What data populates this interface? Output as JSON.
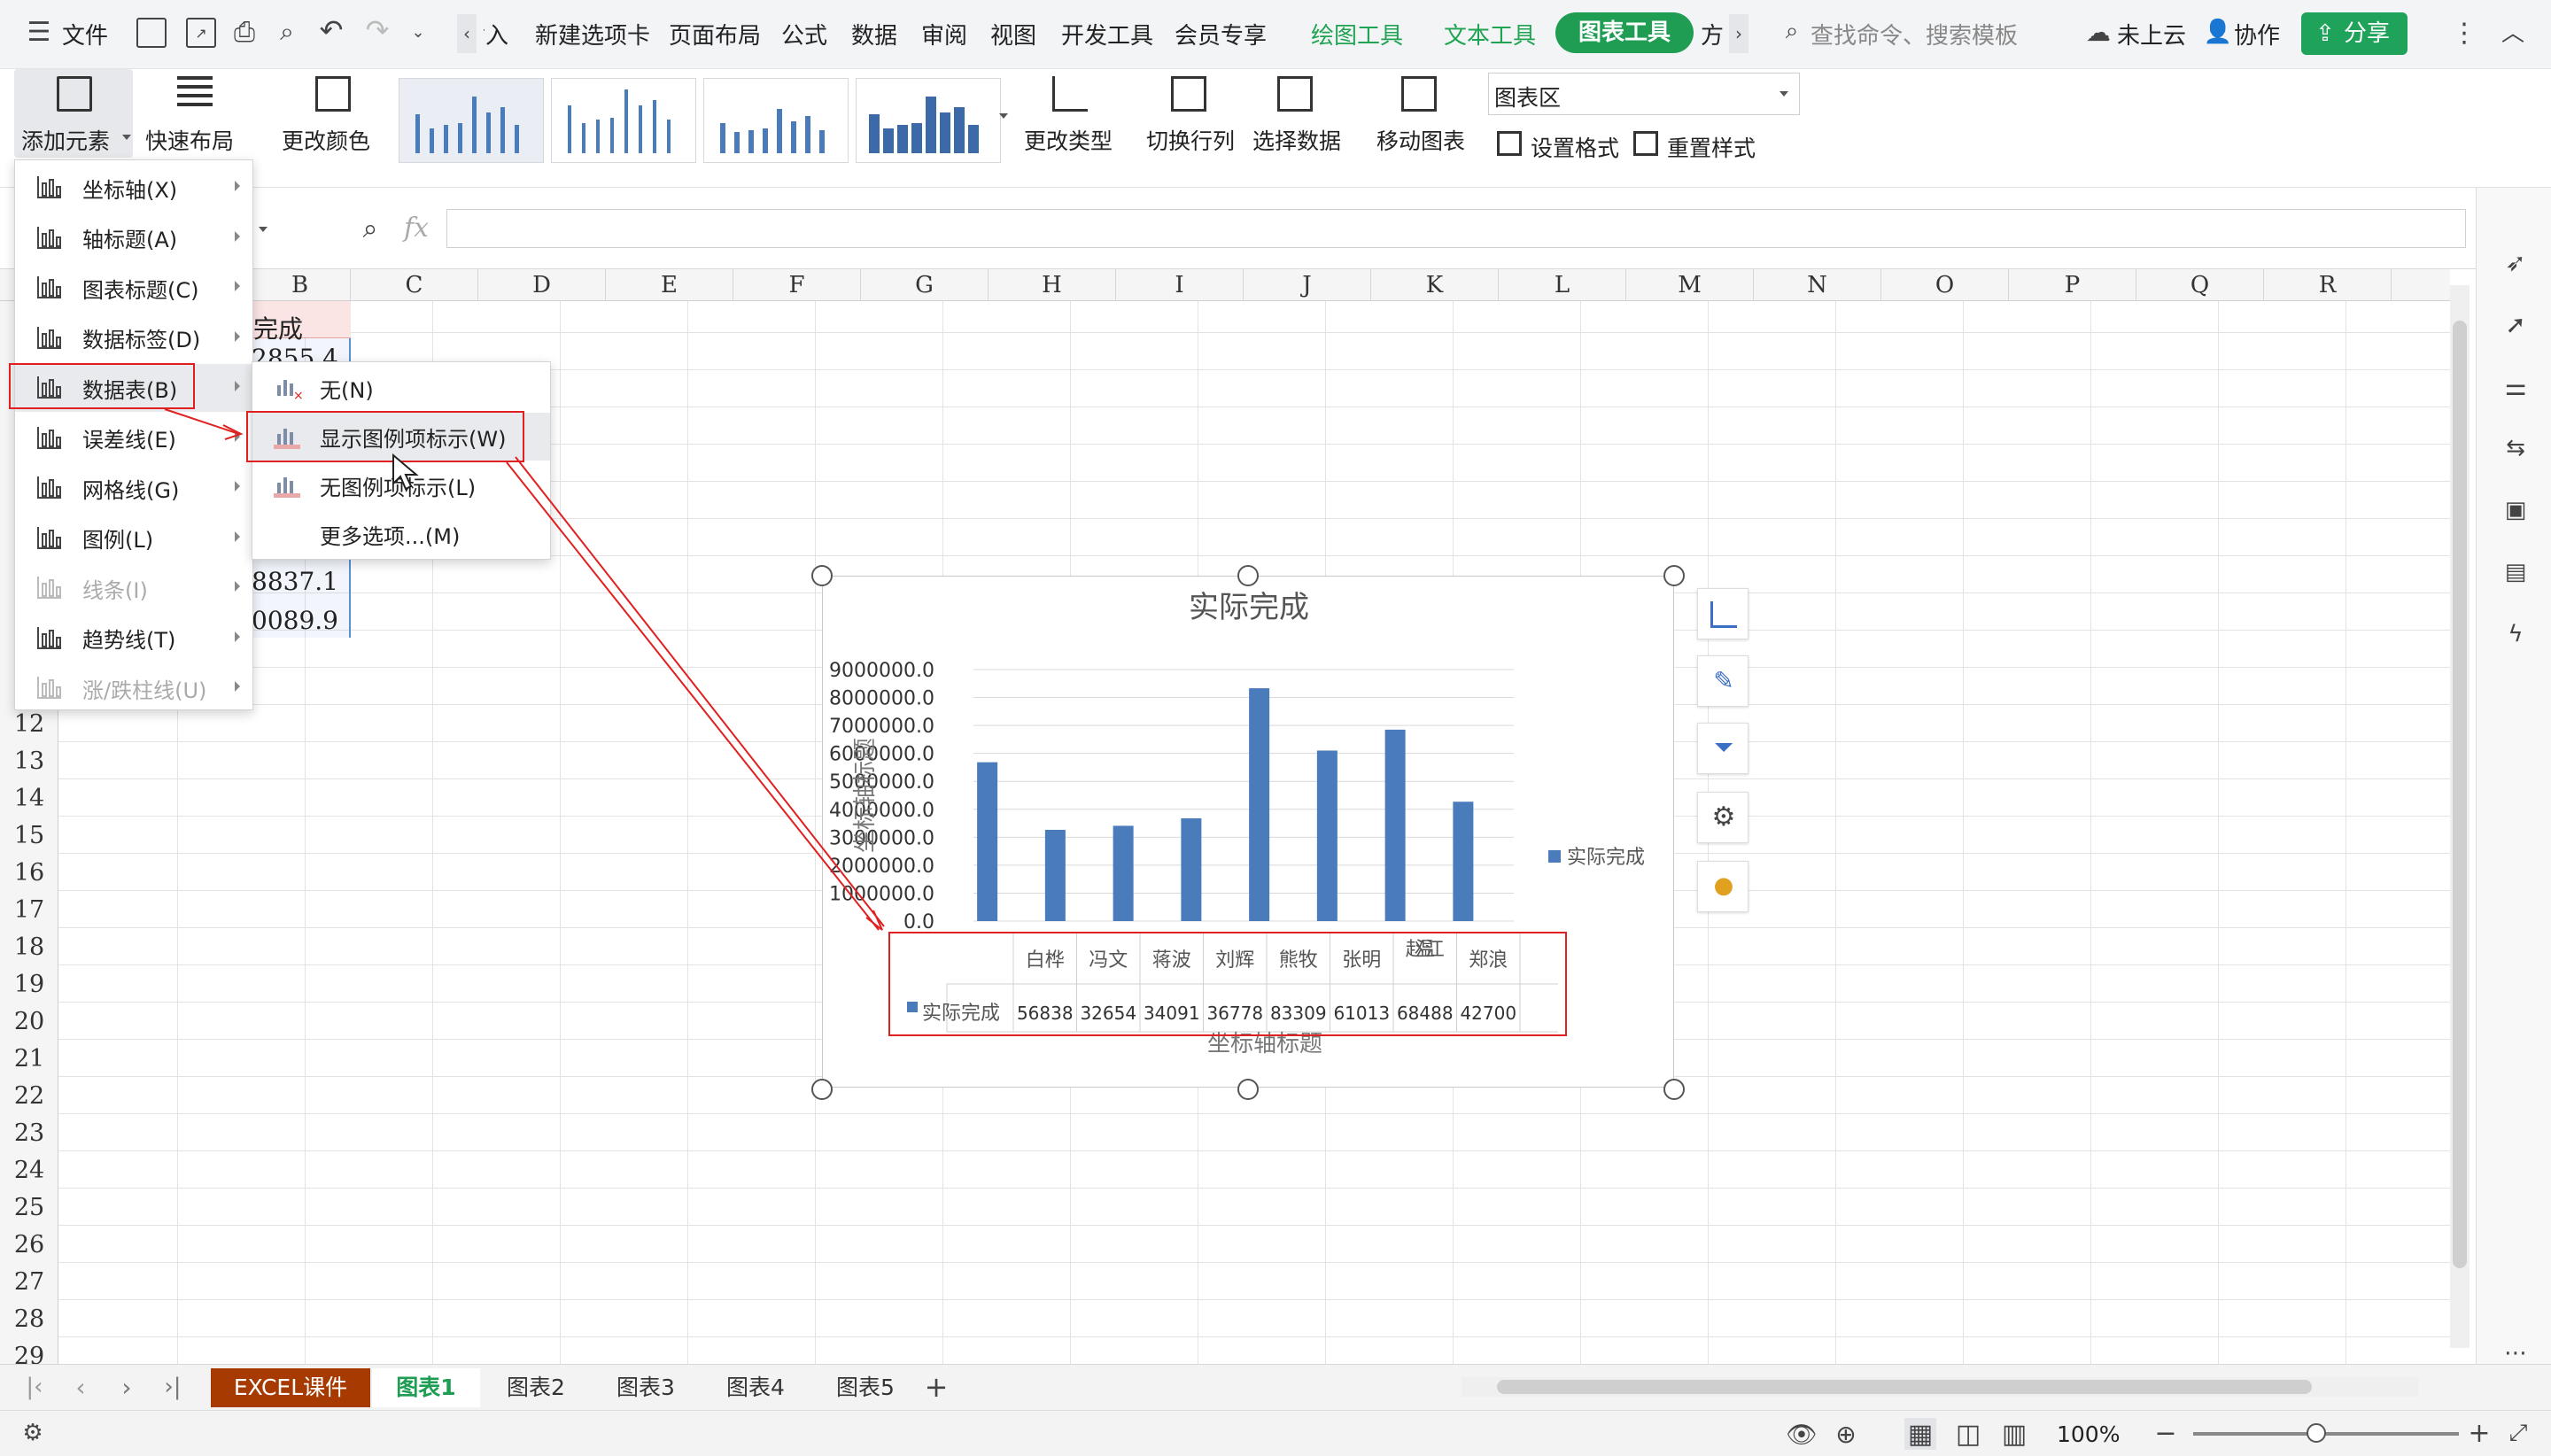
{
  "topbar": {
    "file_menu": "文件",
    "tabs": [
      "插入",
      "新建选项卡",
      "页面布局",
      "公式",
      "数据",
      "审阅",
      "视图",
      "开发工具",
      "会员专享"
    ],
    "tab_first_partial": "‹ 入",
    "context_tabs": [
      "绘图工具",
      "文本工具"
    ],
    "active_tab": "图表工具",
    "tab_more": "方",
    "search_placeholder": "查找命令、搜索模板",
    "cloud": "未上云",
    "collab": "协作",
    "share": "分享"
  },
  "ribbon": {
    "add_element": "添加元素",
    "quick_layout": "快速布局",
    "change_color": "更改颜色",
    "change_type": "更改类型",
    "switch_row_col": "切换行列",
    "select_data": "选择数据",
    "move_chart": "移动图表",
    "chart_area_select": "图表区",
    "set_format": "设置格式",
    "reset_style": "重置样式"
  },
  "formula": {
    "fx": "fx"
  },
  "columns": [
    "B",
    "C",
    "D",
    "E",
    "F",
    "G",
    "H",
    "I",
    "J",
    "K",
    "L",
    "M",
    "N",
    "O",
    "P",
    "Q",
    "R"
  ],
  "rows": [
    "12",
    "13",
    "14",
    "15",
    "16",
    "17",
    "18",
    "19",
    "20",
    "21",
    "22",
    "23",
    "24",
    "25",
    "26",
    "27",
    "28",
    "29"
  ],
  "cells": {
    "b1": "完成",
    "b2": "2855.4",
    "b10": "8837.1",
    "b11": "0089.9"
  },
  "menu1": {
    "items": [
      {
        "label": "坐标轴(X)",
        "disabled": false
      },
      {
        "label": "轴标题(A)",
        "disabled": false
      },
      {
        "label": "图表标题(C)",
        "disabled": false
      },
      {
        "label": "数据标签(D)",
        "disabled": false
      },
      {
        "label": "数据表(B)",
        "disabled": false
      },
      {
        "label": "误差线(E)",
        "disabled": false
      },
      {
        "label": "网格线(G)",
        "disabled": false
      },
      {
        "label": "图例(L)",
        "disabled": false
      },
      {
        "label": "线条(I)",
        "disabled": true
      },
      {
        "label": "趋势线(T)",
        "disabled": false
      },
      {
        "label": "涨/跌柱线(U)",
        "disabled": true
      }
    ]
  },
  "menu2": {
    "items": [
      {
        "label": "无(N)"
      },
      {
        "label": "显示图例项标示(W)"
      },
      {
        "label": "无图例项标示(L)"
      },
      {
        "label": "更多选项...(M)"
      }
    ]
  },
  "chart_data": {
    "type": "bar",
    "title": "实际完成",
    "ylabel": "坐标轴标题",
    "xlabel": "坐标轴标题",
    "ylim": [
      0,
      9000000
    ],
    "yticks": [
      "9000000.0",
      "8000000.0",
      "7000000.0",
      "6000000.0",
      "5000000.0",
      "4000000.0",
      "3000000.0",
      "2000000.0",
      "1000000.0",
      "0.0"
    ],
    "categories": [
      "白桦",
      "冯文",
      "蒋波",
      "刘辉",
      "熊牧",
      "张明",
      "赵温江",
      "郑浪"
    ],
    "series": [
      {
        "name": "实际完成",
        "values": [
          5683800,
          3265400,
          3409100,
          3677800,
          8330900,
          6101300,
          6848800,
          4270000
        ]
      }
    ],
    "table_values": [
      "56838",
      "32654",
      "34091",
      "36778",
      "83309",
      "61013",
      "68488",
      "42700"
    ],
    "legend": "right",
    "grid": true,
    "bar_color": "#4a7cbc"
  },
  "sheets": {
    "tabs": [
      "EXCEL课件",
      "图表1",
      "图表2",
      "图表3",
      "图表4",
      "图表5"
    ],
    "active": "图表1"
  },
  "status": {
    "zoom": "100%"
  }
}
